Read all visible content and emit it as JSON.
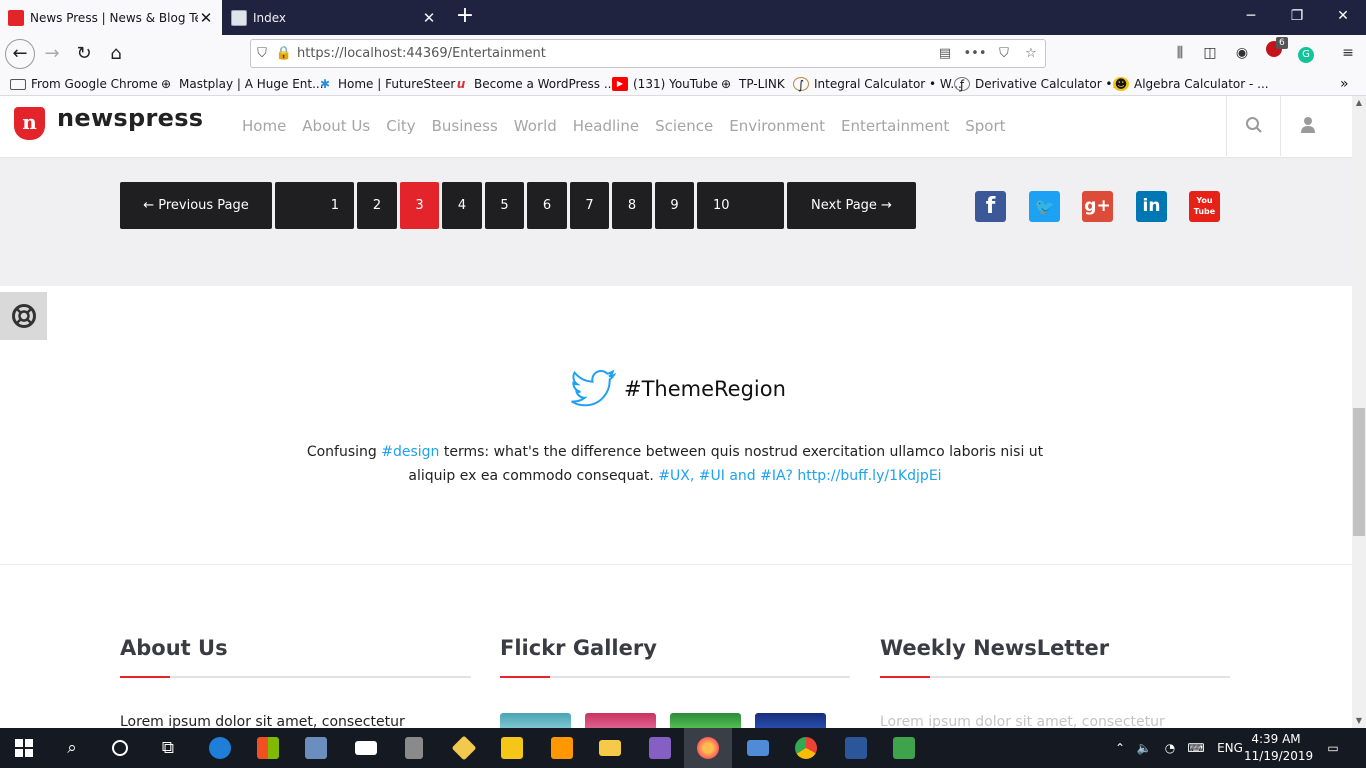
{
  "browser": {
    "tabs": [
      {
        "title": "News Press | News & Blog Template",
        "active": true
      },
      {
        "title": "Index",
        "active": false
      }
    ],
    "window_controls": {
      "minimize": "─",
      "restore": "❐",
      "close": "✕"
    },
    "url": "https://localhost:44369/Entertainment",
    "extension_badge": "6",
    "bookmarks": [
      {
        "label": "From Google Chrome",
        "icon": "folder-icon"
      },
      {
        "label": "Mastplay | A Huge Ent...",
        "icon": "globe-icon"
      },
      {
        "label": "Home | FutureSteer",
        "icon": "futuresteer-icon"
      },
      {
        "label": "Become a WordPress ...",
        "icon": "wordpress-icon"
      },
      {
        "label": "(131) YouTube",
        "icon": "youtube-icon"
      },
      {
        "label": "TP-LINK",
        "icon": "globe-icon"
      },
      {
        "label": "Integral Calculator • W...",
        "icon": "integral-icon"
      },
      {
        "label": "Derivative Calculator •...",
        "icon": "derivative-icon"
      },
      {
        "label": "Algebra Calculator - ...",
        "icon": "algebra-icon"
      }
    ]
  },
  "site": {
    "logo_text": "newspress",
    "nav": [
      "Home",
      "About Us",
      "City",
      "Business",
      "World",
      "Headline",
      "Science",
      "Environment",
      "Entertainment",
      "Sport"
    ]
  },
  "pagination": {
    "prev_label": "← Previous Page",
    "next_label": "Next Page →",
    "pages": [
      "1",
      "2",
      "3",
      "4",
      "5",
      "6",
      "7",
      "8",
      "9",
      "10"
    ],
    "current": "3"
  },
  "social": [
    {
      "name": "facebook",
      "glyph": "f",
      "color": "#3b5998"
    },
    {
      "name": "twitter",
      "glyph": "🐦",
      "color": "#1da1f2"
    },
    {
      "name": "google-plus",
      "glyph": "g+",
      "color": "#dd4b39"
    },
    {
      "name": "linkedin",
      "glyph": "in",
      "color": "#0077b5"
    },
    {
      "name": "youtube",
      "glyph": "You Tube",
      "color": "#e62117"
    }
  ],
  "tweet": {
    "handle": "#ThemeRegion",
    "line1_before": "Confusing ",
    "line1_link": "#design",
    "line1_after": " terms: what's the difference between quis nostrud exercitation ullamco laboris nisi ut",
    "line2_before": "aliquip ex ea commodo consequat. ",
    "line2_link": "#UX, #UI and #IA? http://buff.ly/1KdjpEi"
  },
  "footer": {
    "about": {
      "title": "About Us",
      "text": "Lorem ipsum dolor sit amet, consectetur"
    },
    "flickr": {
      "title": "Flickr Gallery"
    },
    "newsletter": {
      "title": "Weekly NewsLetter",
      "text": "Lorem ipsum dolor sit amet, consectetur"
    }
  },
  "taskbar": {
    "language": "ENG",
    "time": "4:39 AM",
    "date": "11/19/2019"
  },
  "colors": {
    "accent": "#e3242b",
    "tab_strip": "#202340",
    "link": "#1da1f2"
  }
}
